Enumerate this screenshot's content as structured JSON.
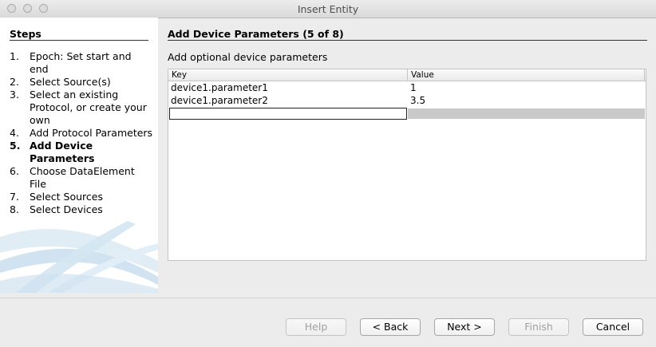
{
  "window": {
    "title": "Insert Entity"
  },
  "steps": {
    "heading": "Steps",
    "items": [
      {
        "num": "1.",
        "label": "Epoch: Set start and end"
      },
      {
        "num": "2.",
        "label": "Select Source(s)"
      },
      {
        "num": "3.",
        "label": "Select an existing Protocol, or create your own"
      },
      {
        "num": "4.",
        "label": "Add Protocol Parameters"
      },
      {
        "num": "5.",
        "label": "Add Device Parameters"
      },
      {
        "num": "6.",
        "label": "Choose DataElement File"
      },
      {
        "num": "7.",
        "label": "Select Sources"
      },
      {
        "num": "8.",
        "label": "Select Devices"
      }
    ]
  },
  "main": {
    "heading": "Add Device Parameters (5 of 8)",
    "description": "Add optional device parameters",
    "table": {
      "columns": [
        "Key",
        "Value"
      ],
      "rows": [
        {
          "key": "device1.parameter1",
          "value": "1"
        },
        {
          "key": "device1.parameter2",
          "value": "3.5"
        }
      ],
      "new_row": {
        "key": "",
        "value": ""
      }
    }
  },
  "buttons": {
    "help": "Help",
    "back": "< Back",
    "next": "Next >",
    "finish": "Finish",
    "cancel": "Cancel"
  },
  "colors": {
    "selection_gray": "#c9c9c9",
    "swoosh": "#c6dcec"
  }
}
